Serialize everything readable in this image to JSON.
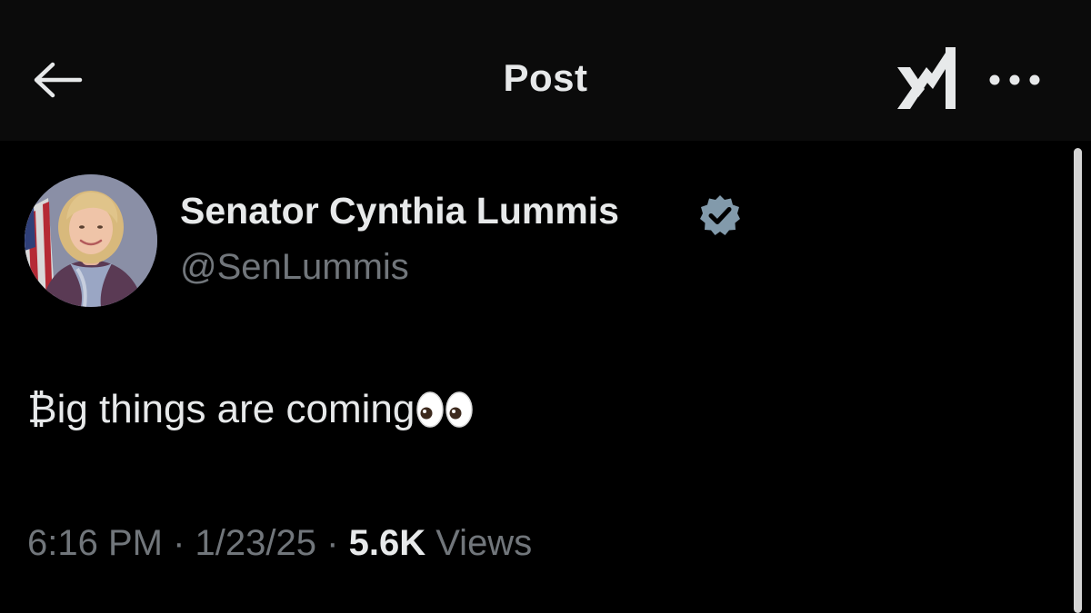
{
  "header": {
    "title": "Post",
    "back_icon": "arrow-left-icon",
    "grok_icon": "grok-icon",
    "more_icon": "ellipsis-icon"
  },
  "post": {
    "author": {
      "display_name": "Senator Cynthia Lummis",
      "handle": "@SenLummis",
      "verified": true,
      "verified_badge_color": "#829aab"
    },
    "text": "₿ig things are coming",
    "text_emoji": "eyes-icon",
    "meta": {
      "time": "6:16 PM",
      "separator": "·",
      "date": "1/23/25",
      "views_count": "5.6K",
      "views_label": "Views"
    }
  },
  "colors": {
    "background": "#000000",
    "header_background": "#0b0b0b",
    "primary_text": "#e7e9ea",
    "secondary_text": "#71767b"
  }
}
